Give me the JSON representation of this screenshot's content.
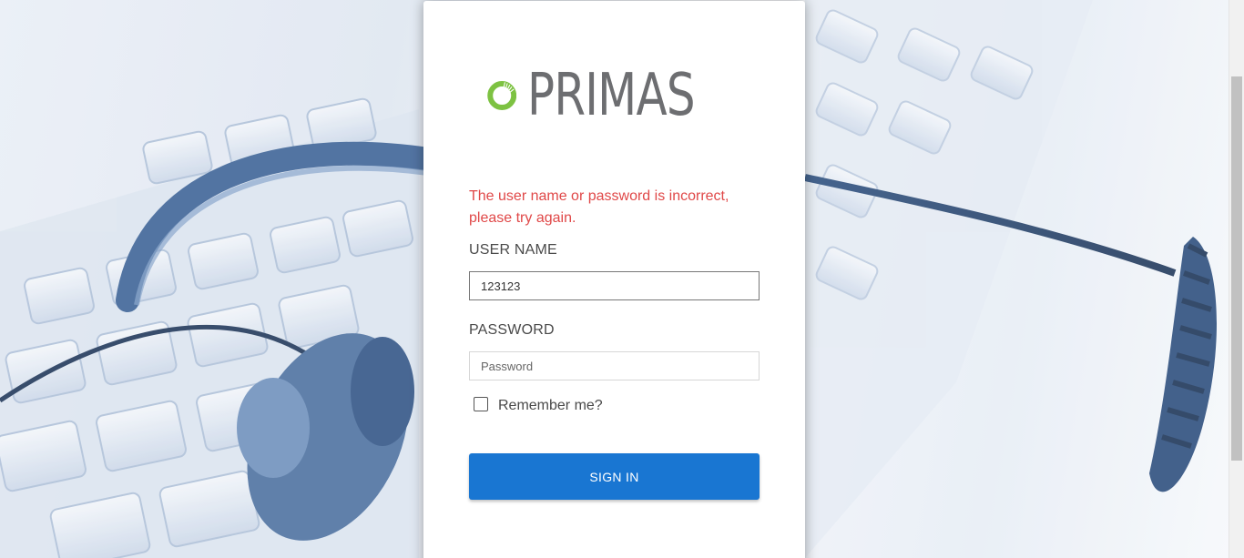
{
  "brand": {
    "name": "PRIMAS",
    "logo_icon": "primas-ring-logo",
    "accent_color": "#7dc242",
    "text_color": "#6d6e71"
  },
  "login": {
    "error_message": "The user name or password is incorrect, please try again.",
    "error_color": "#e04848",
    "username_label": "USER NAME",
    "username_value": "123123",
    "password_label": "PASSWORD",
    "password_placeholder": "Password",
    "remember_label": "Remember me?",
    "remember_checked": false,
    "signin_label": "SIGN IN",
    "signin_color": "#1976d2"
  },
  "background": {
    "image": "keyboard-and-headset-photo",
    "tint": "#3a6aa8"
  }
}
